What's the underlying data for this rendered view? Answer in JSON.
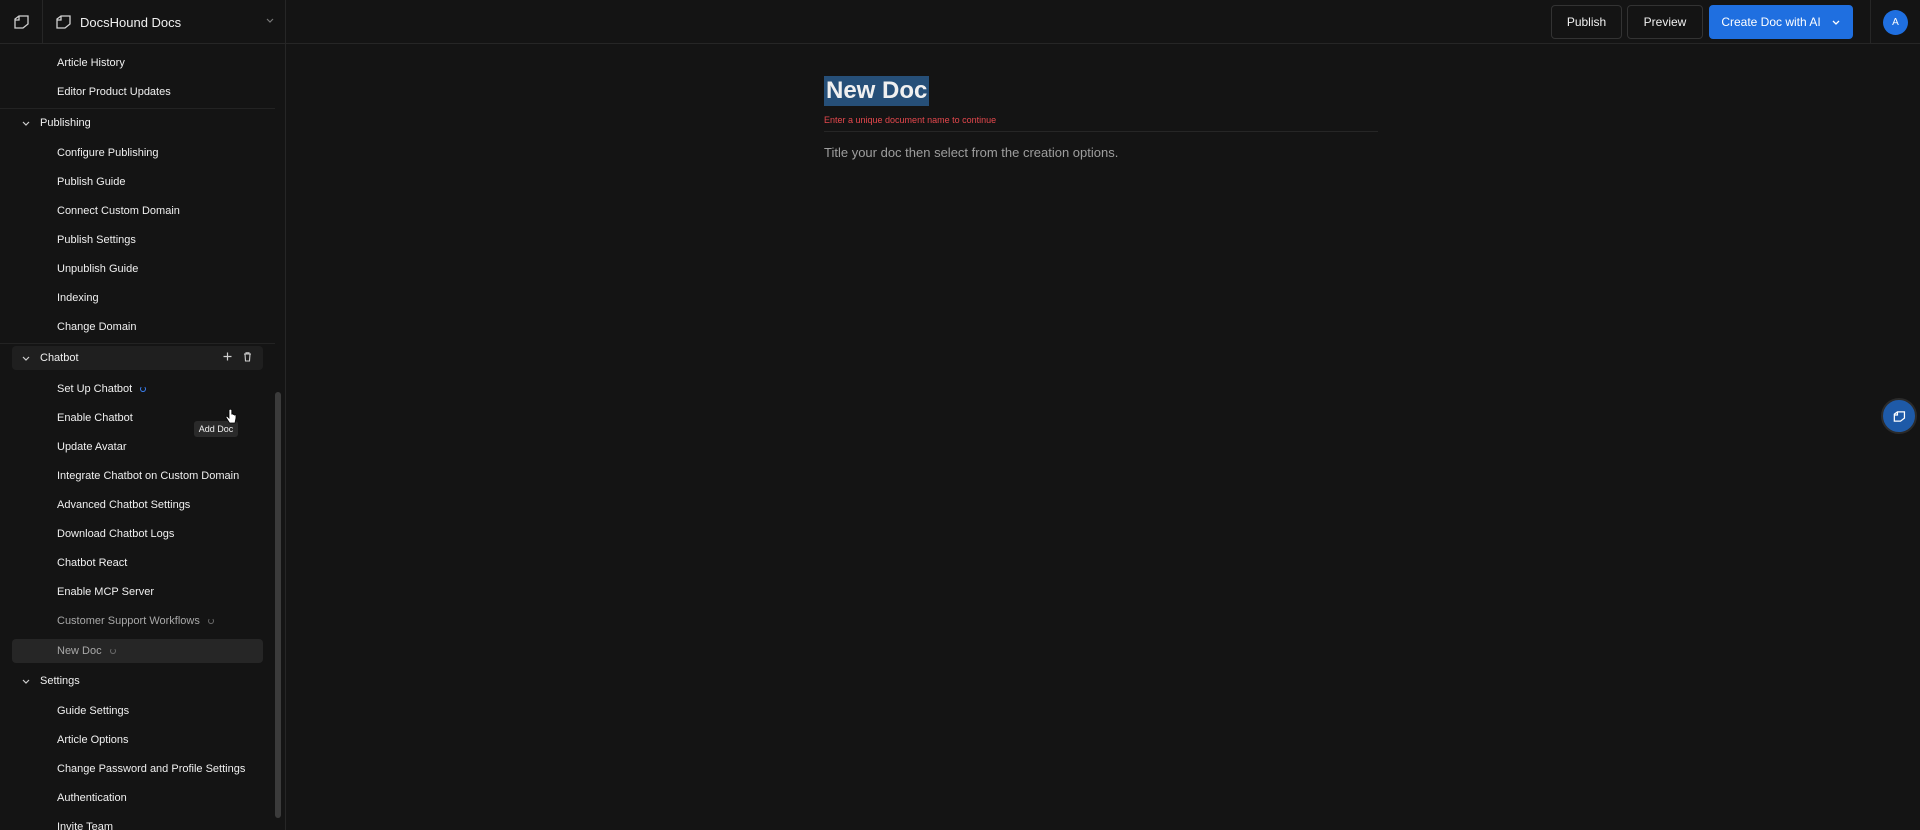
{
  "header": {
    "project_name": "DocsHound Docs",
    "publish_label": "Publish",
    "preview_label": "Preview",
    "create_ai_label": "Create Doc with AI",
    "avatar_initial": "A",
    "brand_color": "#1f6fe0"
  },
  "sidebar": {
    "top_items": [
      {
        "label": "Article History"
      },
      {
        "label": "Editor Product Updates"
      }
    ],
    "groups": [
      {
        "label": "Publishing",
        "items": [
          {
            "label": "Configure Publishing"
          },
          {
            "label": "Publish Guide"
          },
          {
            "label": "Connect Custom Domain"
          },
          {
            "label": "Publish Settings"
          },
          {
            "label": "Unpublish Guide"
          },
          {
            "label": "Indexing"
          },
          {
            "label": "Change Domain"
          }
        ]
      },
      {
        "label": "Chatbot",
        "hovered": true,
        "items": [
          {
            "label": "Set Up Chatbot",
            "status": "loading"
          },
          {
            "label": "Enable Chatbot"
          },
          {
            "label": "Update Avatar"
          },
          {
            "label": "Integrate Chatbot on Custom Domain"
          },
          {
            "label": "Advanced Chatbot Settings"
          },
          {
            "label": "Download Chatbot Logs"
          },
          {
            "label": "Chatbot React"
          },
          {
            "label": "Enable MCP Server"
          },
          {
            "label": "Customer Support Workflows",
            "status": "pending"
          },
          {
            "label": "New Doc",
            "status": "pending",
            "selected": true
          }
        ]
      },
      {
        "label": "Settings",
        "items": [
          {
            "label": "Guide Settings"
          },
          {
            "label": "Article Options"
          },
          {
            "label": "Change Password and Profile Settings"
          },
          {
            "label": "Authentication"
          },
          {
            "label": "Invite Team"
          }
        ]
      }
    ],
    "tooltip": "Add Doc",
    "icons": {
      "add": "plus-icon",
      "delete": "trash-icon",
      "collapse": "chevron-down-icon"
    }
  },
  "editor": {
    "title": "New Doc",
    "error": "Enter a unique document name to continue",
    "hint": "Title your doc then select from the creation options."
  }
}
